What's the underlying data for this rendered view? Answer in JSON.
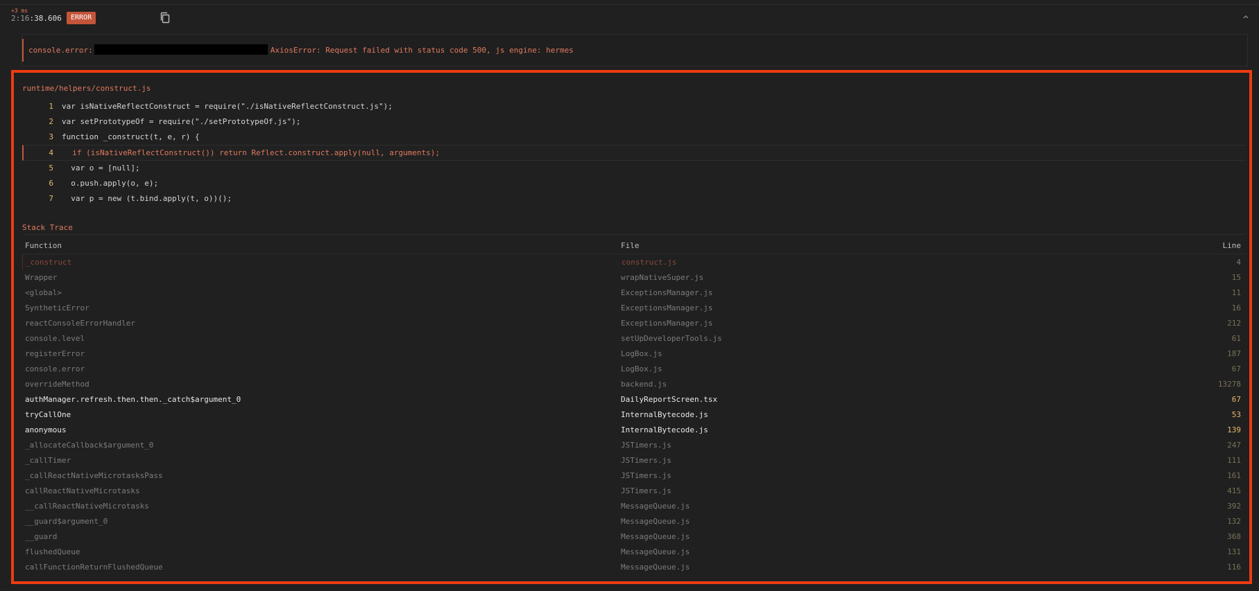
{
  "header": {
    "delta": "+3 ms",
    "time_dim": "2:16",
    "time_main": ":38.606",
    "level_badge": "ERROR",
    "copy_icon": "copy-icon",
    "collapse_icon": "chevron-up-icon"
  },
  "message": {
    "prefix": "console.error:",
    "text": "AxiosError: Request failed with status code 500, js engine: hermes"
  },
  "colors": {
    "accent": "#e07a5f",
    "badge": "#c4553b",
    "highlight_border": "#ee3b12",
    "line_number": "#e8b86d"
  },
  "code_frame": {
    "file": "runtime/helpers/construct.js",
    "lines": [
      {
        "num": "1",
        "code": "var isNativeReflectConstruct = require(\"./isNativeReflectConstruct.js\");",
        "highlight": false
      },
      {
        "num": "2",
        "code": "var setPrototypeOf = require(\"./setPrototypeOf.js\");",
        "highlight": false
      },
      {
        "num": "3",
        "code": "function _construct(t, e, r) {",
        "highlight": false
      },
      {
        "num": "4",
        "code": "  if (isNativeReflectConstruct()) return Reflect.construct.apply(null, arguments);",
        "highlight": true
      },
      {
        "num": "5",
        "code": "  var o = [null];",
        "highlight": false
      },
      {
        "num": "6",
        "code": "  o.push.apply(o, e);",
        "highlight": false
      },
      {
        "num": "7",
        "code": "  var p = new (t.bind.apply(t, o))();",
        "highlight": false
      }
    ]
  },
  "stack_trace": {
    "title": "Stack Trace",
    "headers": {
      "function": "Function",
      "file": "File",
      "line": "Line"
    },
    "rows": [
      {
        "fn": "_construct",
        "file": "construct.js",
        "line": "4",
        "style": "sel"
      },
      {
        "fn": "Wrapper",
        "file": "wrapNativeSuper.js",
        "line": "15",
        "style": "dim"
      },
      {
        "fn": "<global>",
        "file": "ExceptionsManager.js",
        "line": "11",
        "style": "dim"
      },
      {
        "fn": "SyntheticError",
        "file": "ExceptionsManager.js",
        "line": "16",
        "style": "dim"
      },
      {
        "fn": "reactConsoleErrorHandler",
        "file": "ExceptionsManager.js",
        "line": "212",
        "style": "dim"
      },
      {
        "fn": "console.level",
        "file": "setUpDeveloperTools.js",
        "line": "61",
        "style": "dim"
      },
      {
        "fn": "registerError",
        "file": "LogBox.js",
        "line": "187",
        "style": "dim"
      },
      {
        "fn": "console.error",
        "file": "LogBox.js",
        "line": "67",
        "style": "dim"
      },
      {
        "fn": "overrideMethod",
        "file": "backend.js",
        "line": "13278",
        "style": "dim"
      },
      {
        "fn": "authManager.refresh.then.then._catch$argument_0",
        "file": "DailyReportScreen.tsx",
        "line": "67",
        "style": "bright"
      },
      {
        "fn": "tryCallOne",
        "file": "InternalBytecode.js",
        "line": "53",
        "style": "bright"
      },
      {
        "fn": "anonymous",
        "file": "InternalBytecode.js",
        "line": "139",
        "style": "bright"
      },
      {
        "fn": "_allocateCallback$argument_0",
        "file": "JSTimers.js",
        "line": "247",
        "style": "dim"
      },
      {
        "fn": "_callTimer",
        "file": "JSTimers.js",
        "line": "111",
        "style": "dim"
      },
      {
        "fn": "_callReactNativeMicrotasksPass",
        "file": "JSTimers.js",
        "line": "161",
        "style": "dim"
      },
      {
        "fn": "callReactNativeMicrotasks",
        "file": "JSTimers.js",
        "line": "415",
        "style": "dim"
      },
      {
        "fn": "__callReactNativeMicrotasks",
        "file": "MessageQueue.js",
        "line": "392",
        "style": "dim"
      },
      {
        "fn": "__guard$argument_0",
        "file": "MessageQueue.js",
        "line": "132",
        "style": "dim"
      },
      {
        "fn": "__guard",
        "file": "MessageQueue.js",
        "line": "368",
        "style": "dim"
      },
      {
        "fn": "flushedQueue",
        "file": "MessageQueue.js",
        "line": "131",
        "style": "dim"
      },
      {
        "fn": "callFunctionReturnFlushedQueue",
        "file": "MessageQueue.js",
        "line": "116",
        "style": "dim"
      }
    ]
  }
}
